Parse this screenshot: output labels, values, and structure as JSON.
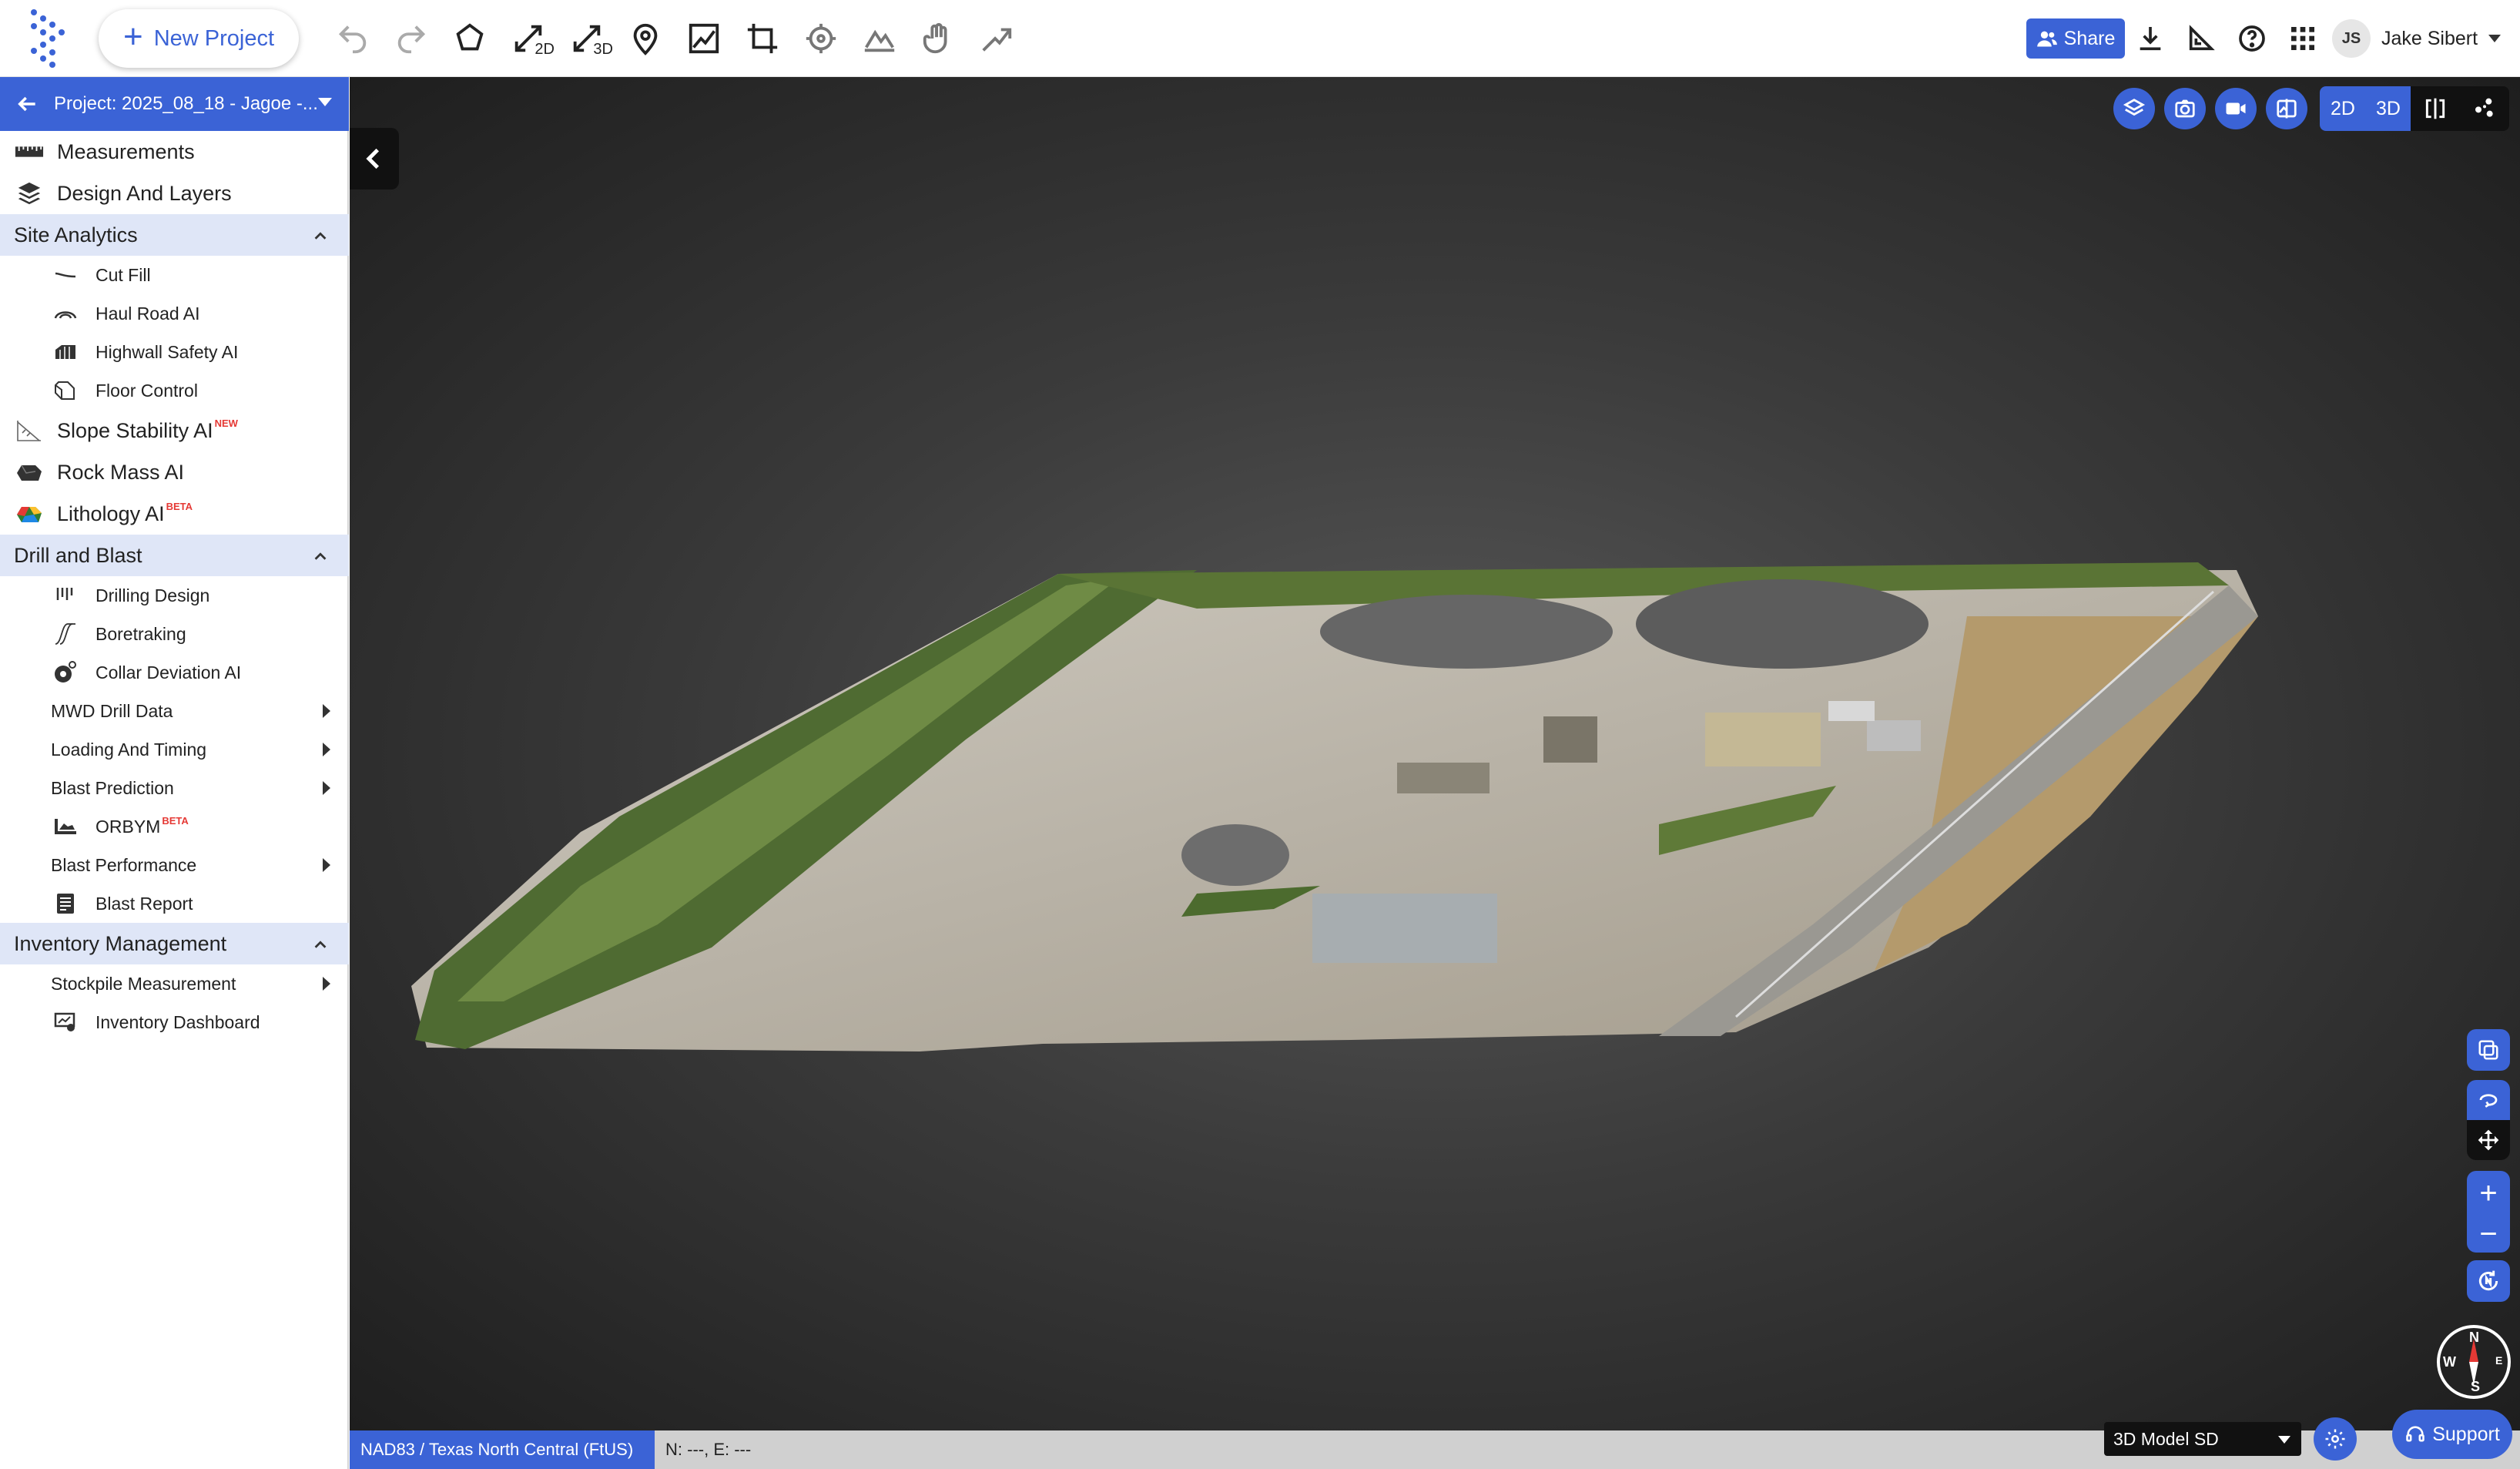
{
  "toolbar": {
    "new_project_label": "New Project",
    "tools": [
      {
        "name": "undo-icon"
      },
      {
        "name": "redo-icon"
      },
      {
        "name": "polygon-icon"
      },
      {
        "name": "measure-2d-icon",
        "sub": "2D"
      },
      {
        "name": "measure-3d-icon",
        "sub": "3D"
      },
      {
        "name": "location-pin-icon"
      },
      {
        "name": "profile-chart-icon"
      },
      {
        "name": "crop-icon"
      },
      {
        "name": "target-icon"
      },
      {
        "name": "terrain-icon"
      },
      {
        "name": "hand-icon"
      },
      {
        "name": "slope-icon"
      }
    ],
    "share_label": "Share"
  },
  "user": {
    "initials": "JS",
    "name": "Jake Sibert"
  },
  "sidebar": {
    "project_label": "Project: 2025_08_18 - Jagoe -...",
    "items": [
      {
        "label": "Measurements"
      },
      {
        "label": "Design And Layers"
      }
    ],
    "sections": [
      {
        "title": "Site Analytics",
        "items": [
          {
            "label": "Cut Fill"
          },
          {
            "label": "Haul Road AI"
          },
          {
            "label": "Highwall Safety AI"
          },
          {
            "label": "Floor Control"
          },
          {
            "label": "Slope Stability AI",
            "badge": "NEW"
          },
          {
            "label": "Rock Mass AI"
          },
          {
            "label": "Lithology AI",
            "badge": "BETA"
          }
        ]
      },
      {
        "title": "Drill and Blast",
        "items": [
          {
            "label": "Drilling Design"
          },
          {
            "label": "Boretraking"
          },
          {
            "label": "Collar Deviation AI"
          },
          {
            "label": "MWD Drill Data"
          },
          {
            "label": "Loading And Timing"
          },
          {
            "label": "Blast Prediction"
          },
          {
            "label": "ORBYM",
            "badge": "BETA"
          },
          {
            "label": "Blast Performance"
          },
          {
            "label": "Blast Report"
          }
        ]
      },
      {
        "title": "Inventory Management",
        "items": [
          {
            "label": "Stockpile Measurement"
          },
          {
            "label": "Inventory Dashboard"
          }
        ]
      }
    ]
  },
  "viewer": {
    "mode_2d": "2D",
    "mode_3d": "3D",
    "active_mode": "2D",
    "compass": {
      "n": "N",
      "s": "S",
      "e": "E",
      "w": "W"
    }
  },
  "statusbar": {
    "crs": "NAD83 / Texas North Central (FtUS)",
    "coords": "N: ---, E: ---"
  },
  "model_select": {
    "value": "3D Model SD"
  },
  "support_label": "Support",
  "colors": {
    "accent": "#3b63d6",
    "section_bg": "#dfe6f7",
    "badge": "#e53935"
  }
}
